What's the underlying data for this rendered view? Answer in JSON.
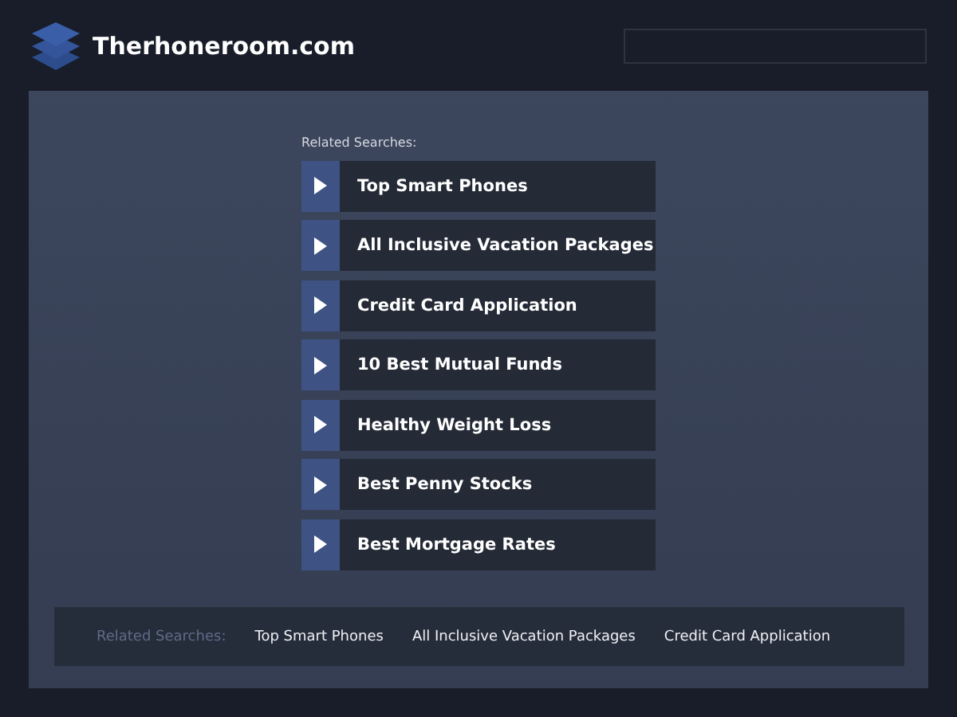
{
  "header": {
    "site_name": "Therhoneroom.com"
  },
  "related": {
    "heading": "Related Searches:",
    "items": [
      {
        "label": "Top Smart Phones"
      },
      {
        "label": "All Inclusive Vacation Packages"
      },
      {
        "label": "Credit Card Application"
      },
      {
        "label": "10 Best Mutual Funds"
      },
      {
        "label": "Healthy Weight Loss"
      },
      {
        "label": "Best Penny Stocks"
      },
      {
        "label": "Best Mortgage Rates"
      }
    ]
  },
  "footer_bar": {
    "heading": "Related Searches:",
    "links": [
      "Top Smart Phones",
      "All Inclusive Vacation Packages",
      "Credit Card Application"
    ]
  }
}
